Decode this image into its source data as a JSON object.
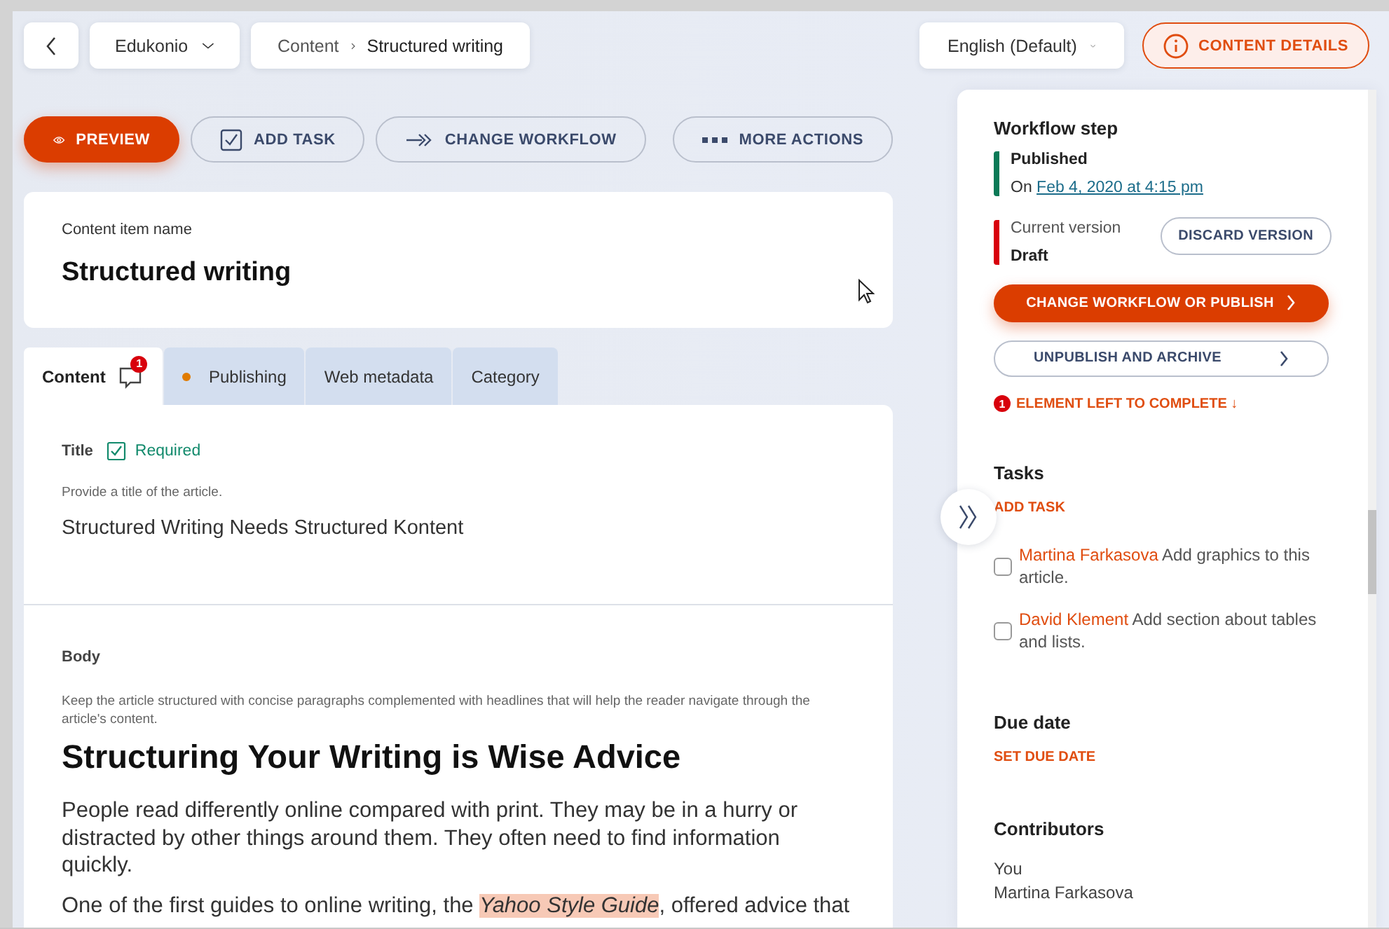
{
  "top_bar": {
    "project": "Edukonio",
    "breadcrumb": [
      "Content",
      "Structured writing"
    ],
    "language": "English (Default)",
    "details_button": "CONTENT DETAILS"
  },
  "actions": [
    {
      "label": "PREVIEW",
      "kind": "preview"
    },
    {
      "label": "ADD TASK",
      "kind": "task"
    },
    {
      "label": "CHANGE WORKFLOW",
      "kind": "workflow"
    },
    {
      "label": "MORE ACTIONS",
      "kind": "more"
    }
  ],
  "item_name": {
    "label": "Content item name",
    "value": "Structured writing"
  },
  "tabs": [
    {
      "label": "Content",
      "selected": true,
      "badge": "1"
    },
    {
      "label": "Publishing",
      "selected": false,
      "color": "#e07b00"
    },
    {
      "label": "Web metadata",
      "selected": false
    },
    {
      "label": "Category",
      "selected": false
    }
  ],
  "elements": [
    {
      "kind": "text",
      "label": "Title",
      "status": "Required",
      "complete": true,
      "guideline": "Provide a title of the article.",
      "value": "Structured Writing Needs Structured Kontent"
    },
    {
      "kind": "rich_text",
      "label": "Body",
      "guideline": "Keep the article structured with concise paragraphs complemented with headlines that will help the reader navigate through the article's content.",
      "heading": "Structuring Your Writing is Wise Advice",
      "paragraphs": [
        "People read differently online compared with print. They may be in a hurry or distracted by other things around them. They often need to find information quickly.",
        "One of the first guides to online writing, the *Yahoo Style Guide*, offered advice that"
      ]
    }
  ],
  "sidebar": {
    "workflow": {
      "heading": "Workflow step",
      "published": {
        "label": "Published",
        "prefix": "On",
        "date": "Feb 4, 2020 at 4:15 pm",
        "color": "#0b7a57"
      },
      "current": {
        "label": "Current version",
        "value": "Draft",
        "color": "#d8000c"
      },
      "discard": "DISCARD VERSION",
      "primary": "CHANGE WORKFLOW OR PUBLISH",
      "secondary": "UNPUBLISH AND ARCHIVE",
      "warning": {
        "count": "1",
        "text": "ELEMENT LEFT TO COMPLETE ↓"
      }
    },
    "tasks": {
      "heading": "Tasks",
      "add": "ADD TASK",
      "items": [
        {
          "assignee": "Martina Farkasova",
          "text": "Add graphics to this article.",
          "checked": false
        },
        {
          "assignee": "David Klement",
          "text": "Add section about tables and lists.",
          "checked": false
        }
      ]
    },
    "due": {
      "heading": "Due date",
      "action": "SET DUE DATE"
    },
    "contributors": {
      "heading": "Contributors",
      "names": [
        "You",
        "Martina Farkasova"
      ]
    }
  }
}
